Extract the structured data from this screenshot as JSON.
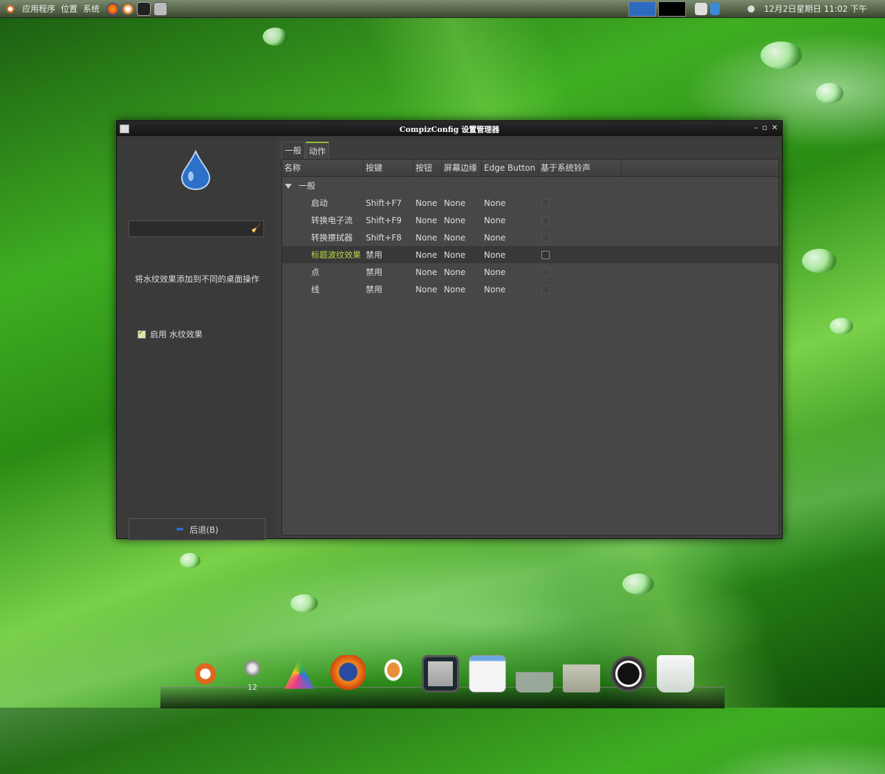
{
  "top_panel": {
    "menus": [
      "应用程序",
      "位置",
      "系统"
    ],
    "clock": "12月2日星期日 11:02 下午"
  },
  "window": {
    "title": "CompizConfig 设置管理器"
  },
  "sidebar": {
    "description": "将水纹效果添加到不同的桌面操作",
    "enable_label": "启用 水纹效果",
    "back_label": "后退(B)"
  },
  "tabs": [
    "一般",
    "动作"
  ],
  "table": {
    "headers": [
      "名称",
      "按键",
      "按钮",
      "屏幕边缘",
      "Edge Button",
      "基于系统铃声"
    ],
    "group": "一般",
    "rows": [
      {
        "name": "启动",
        "key": "Shift+F7",
        "button": "None",
        "edge": "None",
        "edge_button": "None",
        "bell": false
      },
      {
        "name": "转换电子流",
        "key": "Shift+F9",
        "button": "None",
        "edge": "None",
        "edge_button": "None",
        "bell": false
      },
      {
        "name": "转换擦拭器",
        "key": "Shift+F8",
        "button": "None",
        "edge": "None",
        "edge_button": "None",
        "bell": false
      },
      {
        "name": "标题波纹效果",
        "key": "禁用",
        "button": "None",
        "edge": "None",
        "edge_button": "None",
        "bell": false
      },
      {
        "name": "点",
        "key": "禁用",
        "button": "None",
        "edge": "None",
        "edge_button": "None",
        "bell": false
      },
      {
        "name": "线",
        "key": "禁用",
        "button": "None",
        "edge": "None",
        "edge_button": "None",
        "bell": false
      }
    ]
  },
  "dock": {
    "workspace_label": "12",
    "items": [
      "ubuntu-icon",
      "workspace-switcher-icon",
      "photos-icon",
      "firefox-icon",
      "mail-icon",
      "terminal-icon",
      "settings-icon",
      "downloads-icon",
      "folder-icon",
      "shutdown-icon",
      "trash-icon"
    ]
  },
  "colors": {
    "selected_text": "#b7d84a",
    "accent_tab": "#9ac43a"
  }
}
